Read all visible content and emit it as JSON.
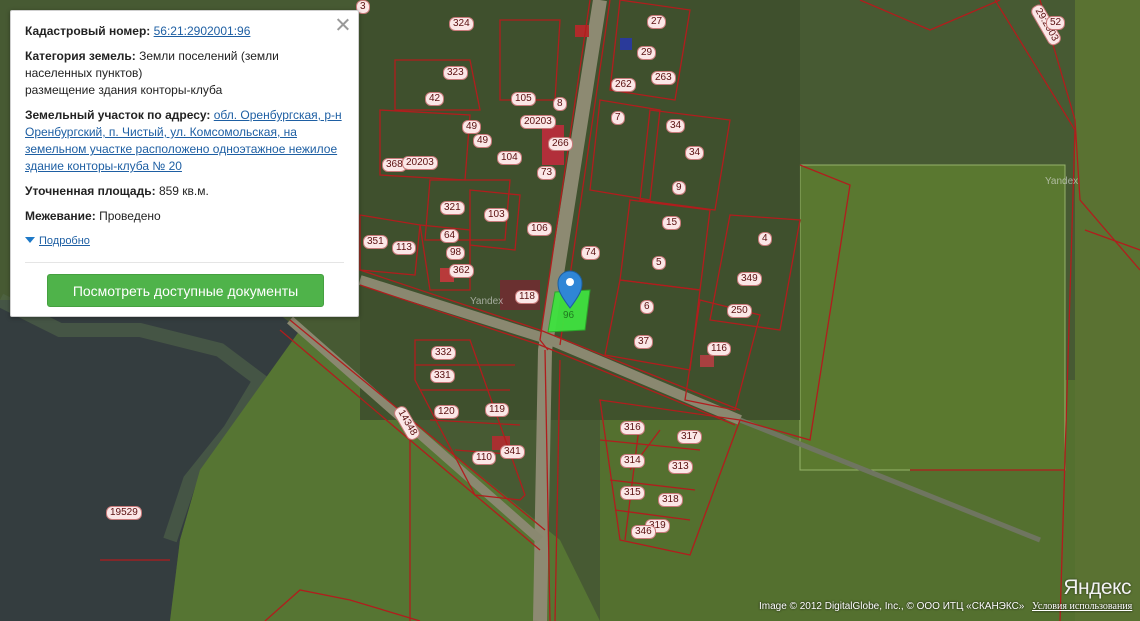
{
  "panel": {
    "cadastral_label": "Кадастровый номер:",
    "cadastral_value": "56:21:2902001:96",
    "category_label": "Категория земель:",
    "category_value": "Земли поселений (земли населенных пунктов)",
    "usage_value": "размещение здания конторы-клуба",
    "address_label": "Земельный участок по адресу:",
    "address_value": "обл. Оренбургская, р-н Оренбургский, п. Чистый, ул. Комсомольская, на земельном участке расположено одноэтажное нежилое здание конторы-клуба № 20",
    "area_label": "Уточненная площадь:",
    "area_value": "859 кв.м.",
    "survey_label": "Межевание:",
    "survey_value": "Проведено",
    "more_label": "Подробно",
    "docs_button": "Посмотреть доступные документы"
  },
  "map": {
    "plot_labels": [
      "3",
      "324",
      "27",
      "29",
      "323",
      "262",
      "263",
      "42",
      "105",
      "8",
      "49",
      "20203",
      "7",
      "34",
      "49",
      "266",
      "368",
      "20203",
      "104",
      "34",
      "73",
      "9",
      "321",
      "103",
      "64",
      "15",
      "351",
      "113",
      "106",
      "4",
      "98",
      "74",
      "5",
      "362",
      "349",
      "118",
      "6",
      "250",
      "37",
      "332",
      "116",
      "331",
      "120",
      "119",
      "316",
      "317",
      "314",
      "313",
      "14348",
      "341",
      "110",
      "315",
      "318",
      "19529",
      "319",
      "346",
      "29:2003",
      "52"
    ],
    "watermark": "Yandex",
    "selected_plot_label": "96"
  },
  "footer": {
    "logo": "Яндекс",
    "copyright": "Image © 2012 DigitalGlobe, Inc., © ООО ИТЦ «СКАНЭКС»",
    "terms": "Условия использования"
  },
  "colors": {
    "boundary": "#b11d1d",
    "selected_plot": "#3fe23f",
    "marker": "#2f86d6",
    "button": "#4fb34a",
    "link": "#1e5fa3"
  }
}
